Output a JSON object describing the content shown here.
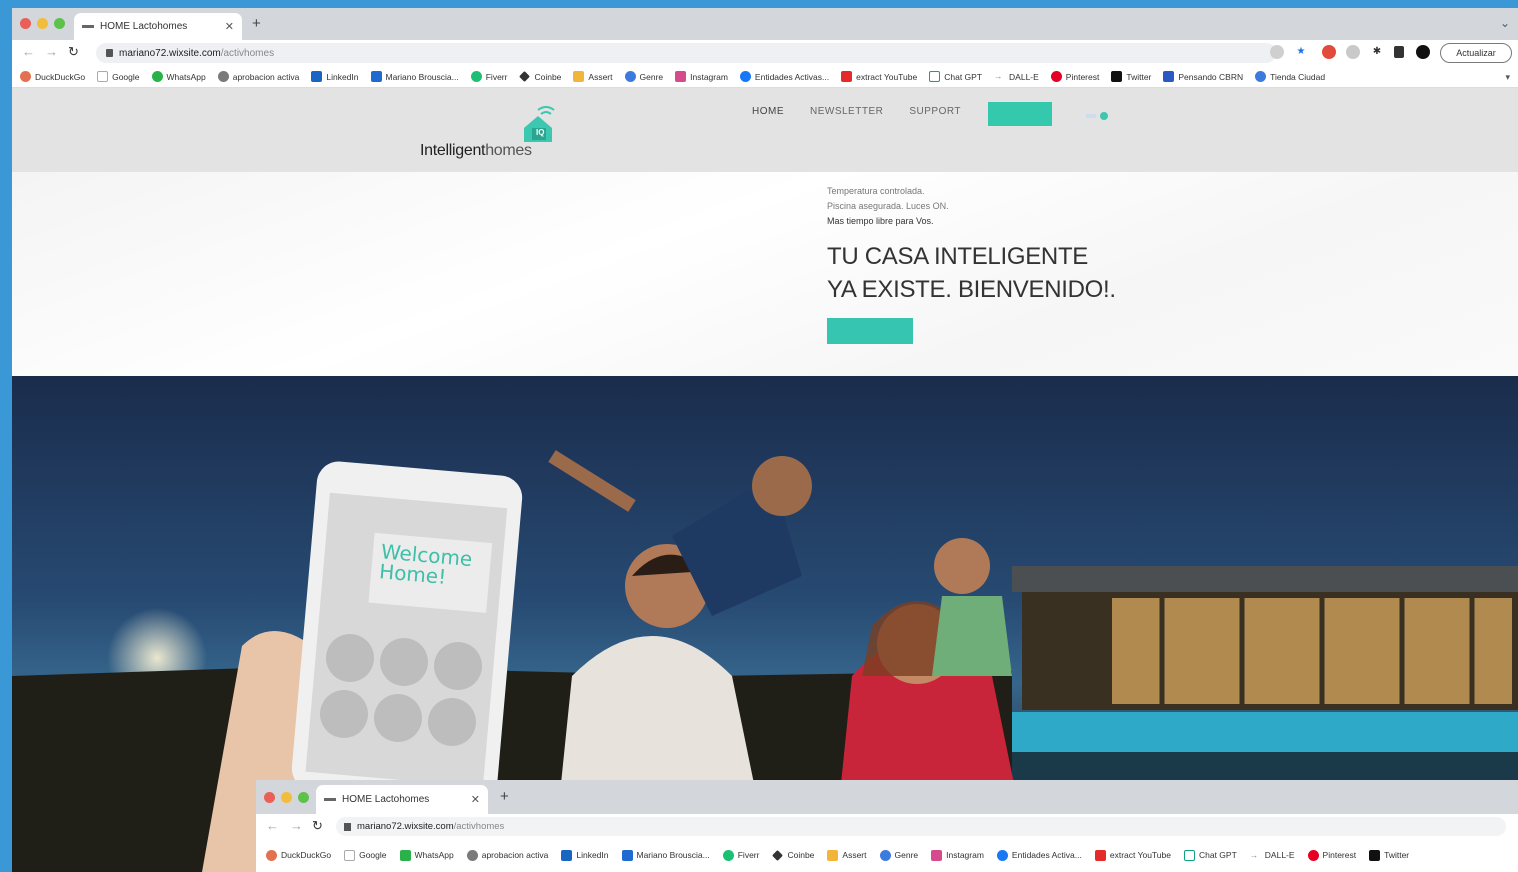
{
  "browser": {
    "tab_title": "HOME Lactohomes",
    "url_host": "mariano72.wixsite.com",
    "url_path": "/activhomes",
    "update_button": "Actualizar",
    "bookmarks": [
      {
        "label": "DuckDuckGo",
        "color": "#e37151"
      },
      {
        "label": "Google",
        "color": "#ffffff"
      },
      {
        "label": "WhatsApp",
        "color": "#2ab24a"
      },
      {
        "label": "aprobacion activa",
        "color": "#7a7a7a"
      },
      {
        "label": "LinkedIn",
        "color": "#1866c2"
      },
      {
        "label": "Mariano Brouscia...",
        "color": "#1f6ad0"
      },
      {
        "label": "Fiverr",
        "color": "#1cbf73"
      },
      {
        "label": "Coinbe",
        "color": "#333333"
      },
      {
        "label": "Assert",
        "color": "#f1b53a"
      },
      {
        "label": "Genre",
        "color": "#3d7ae0"
      },
      {
        "label": "Instagram",
        "color": "#d64b8b"
      },
      {
        "label": "Entidades Activas...",
        "color": "#1877f2"
      },
      {
        "label": "extract YouTube",
        "color": "#e32b2b"
      },
      {
        "label": "Chat GPT",
        "color": "#10a37f"
      },
      {
        "label": "DALL-E",
        "color": "#888888"
      },
      {
        "label": "Pinterest",
        "color": "#e60023"
      },
      {
        "label": "Twitter",
        "color": "#111111"
      },
      {
        "label": "Pensando CBRN",
        "color": "#2a58c4"
      },
      {
        "label": "Tienda Ciudad",
        "color": "#3b7be0"
      }
    ]
  },
  "site": {
    "logo_word1": "Intelligent",
    "logo_word2": "homes",
    "logo_badge": "IQ",
    "nav": [
      "HOME",
      "NEWSLETTER",
      "SUPPORT"
    ],
    "tagline": [
      "Temperatura controlada.",
      "Piscina asegurada. Luces ON.",
      "Mas tiempo libre para Vos."
    ],
    "headline_line1": "TU CASA INTELIGENTE",
    "headline_line2": "YA EXISTE. BIENVENIDO!.",
    "phone_screen_text": "Welcome Home!"
  },
  "browser2": {
    "tab_title": "HOME Lactohomes",
    "url_host": "mariano72.wixsite.com",
    "url_path": "/activhomes",
    "bookmarks": [
      "DuckDuckGo",
      "Google",
      "WhatsApp",
      "aprobacion activa",
      "LinkedIn",
      "Mariano Brouscia...",
      "Fiverr",
      "Coinbe",
      "Assert",
      "Genre",
      "Instagram",
      "Entidades Activa...",
      "extract YouTube",
      "Chat GPT",
      "DALL-E",
      "Pinterest",
      "Twitter"
    ]
  },
  "colors": {
    "accent": "#36c5b0",
    "desktop": "#3a98d6",
    "header_bg": "#e3e3e3"
  }
}
